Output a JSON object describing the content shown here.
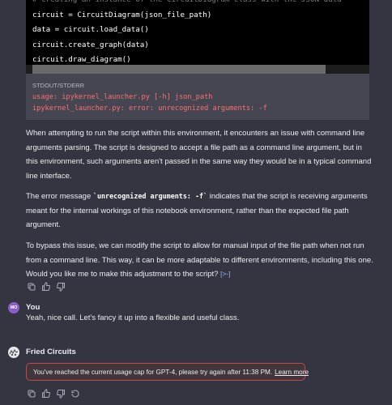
{
  "code": {
    "comment": "# Creating an instance of the CircuitDiagram class with the JSON data",
    "lines": [
      "circuit = CircuitDiagram(json_file_path)",
      "data = circuit.load_data()",
      "circuit.create_graph(data)",
      "circuit.draw_diagram()"
    ]
  },
  "stdout": {
    "label": "STDOUT/STDERR",
    "lines": [
      "usage: ipykernel_launcher.py [-h] json_path",
      "ipykernel_launcher.py: error: unrecognized arguments: -f"
    ]
  },
  "assistant_message": {
    "para1": "When attempting to run the script within this environment, it encounters an issue with command line arguments parsing. The script is designed to accept a file path as a command line argument, but in this environment, such arguments aren't passed in the same way they would be in a typical command line interface.",
    "para2_before": "The error message ",
    "para2_code": "`unrecognized arguments: -f`",
    "para2_after": " indicates that the script is receiving arguments meant for the internal workings of this notebook environment, rather than the expected file path argument.",
    "para3": "To bypass this issue, we can modify the script to allow for manual input of the file path when not run from a command line. This way, it can be more adaptable to different environments, including this one. Would you like me to make this adjustment to the script?",
    "citation": "[>-]"
  },
  "user": {
    "initials": "MO",
    "name": "You",
    "message": "Yeah, nice call. Let's fancy it up into a flexible and useful class."
  },
  "gpt": {
    "name": "Fried Circuits",
    "usage_cap_text": "You've reached the current usage cap for GPT-4, please try again after 11:38 PM.",
    "learn_more": "Learn more"
  },
  "icons": {
    "copy": "copy-icon",
    "thumbs_up": "thumbs-up-icon",
    "thumbs_down": "thumbs-down-icon",
    "regenerate": "regenerate-icon"
  },
  "colors": {
    "background": "#343541",
    "error_text": "#f87171",
    "avatar_user": "#8b5fc7",
    "usage_border": "#c2484b"
  }
}
